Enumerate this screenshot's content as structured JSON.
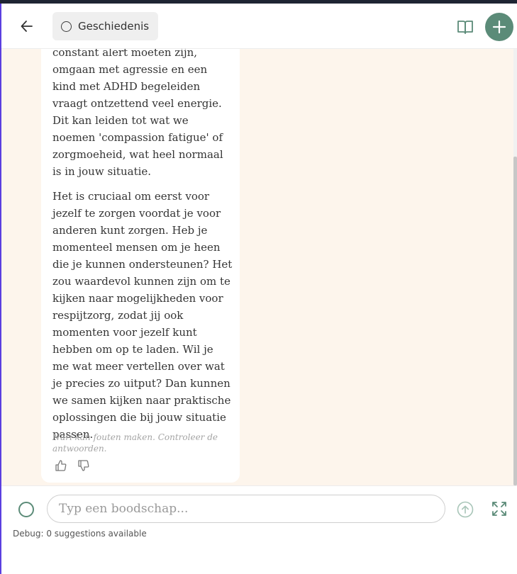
{
  "header": {
    "history_label": "Geschiedenis"
  },
  "message": {
    "paragraph_1": "constant alert moeten zijn, omgaan met agressie en een kind met ADHD begeleiden vraagt ontzettend veel energie. Dit kan leiden tot wat we noemen 'compassion fatigue' of zorgmoeheid, wat heel normaal is in jouw situatie.",
    "paragraph_2": "Het is cruciaal om eerst voor jezelf te zorgen voordat je voor anderen kunt zorgen. Heb je momenteel mensen om je heen die je kunnen ondersteunen? Het zou waardevol kunnen zijn om te kijken naar mogelijkheden voor respijtzorg, zodat jij ook momenten voor jezelf kunt hebben om op te laden. Wil je me wat meer vertellen over wat je precies zo uitput? Dan kunnen we samen kijken naar praktische oplossingen die bij jouw situatie passen.",
    "disclaimer": "Nuri kan fouten maken. Controleer de antwoorden."
  },
  "composer": {
    "placeholder": "Typ een boodschap...",
    "value": ""
  },
  "debug": {
    "text": "Debug: 0 suggestions available"
  },
  "colors": {
    "accent": "#5b8b78",
    "chat_background": "#fdf5ec",
    "bubble_background": "#ffffff"
  },
  "icons": {
    "back": "arrow-left-icon",
    "history": "circle-icon",
    "guide": "book-open-icon",
    "new_chat": "plus-icon",
    "like": "thumbs-up-icon",
    "dislike": "thumbs-down-icon",
    "send": "arrow-up-circle-icon",
    "expand": "expand-icon"
  }
}
